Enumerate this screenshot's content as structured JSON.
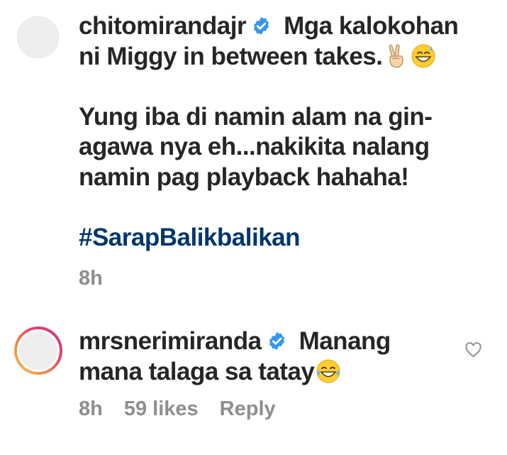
{
  "comments": [
    {
      "username": "chitomirandajr",
      "verified": true,
      "line1": "Mga kalokohan",
      "line2": "ni Miggy in between takes.",
      "emoji1": "victory-hand-emoji",
      "emoji2": "grinning-sweat-emoji",
      "para2": "Yung iba di namin alam na gin-\nagawa nya eh...nakikita nalang\nnamin pag playback hahaha!",
      "hashtag": "#SarapBalikbalikan",
      "time": "8h"
    },
    {
      "username": "mrsnerimiranda",
      "verified": true,
      "line1": "Manang",
      "line2": "mana talaga sa tatay",
      "emoji": "tears-of-joy-emoji",
      "time": "8h",
      "likes": "59 likes",
      "reply": "Reply"
    }
  ],
  "colors": {
    "verified": "#3897f0",
    "hashtag": "#00376b",
    "meta": "#8e8e8e",
    "text": "#262626"
  }
}
